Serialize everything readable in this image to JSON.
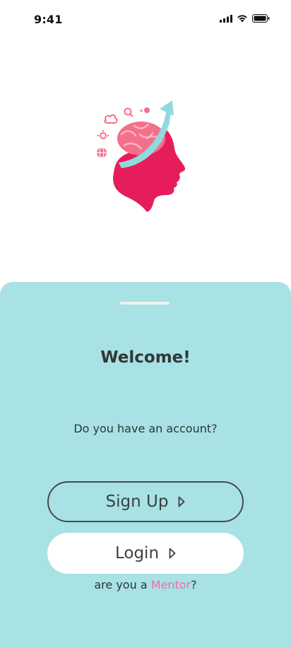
{
  "status_bar": {
    "time": "9:41",
    "icons": [
      "cellular-signal-icon",
      "wifi-icon",
      "battery-icon"
    ]
  },
  "logo": {
    "icon": "brain-head-growth-logo",
    "colors": {
      "face": "#e51e5b",
      "brain": "#f3708a",
      "arrow": "#8fdadd"
    }
  },
  "sheet": {
    "background": "#a8e2e4",
    "welcome": "Welcome!",
    "question": "Do you have an account?",
    "signup_label": "Sign Up",
    "login_label": "Login",
    "mentor_prefix": "are you a ",
    "mentor_link": "Mentor",
    "mentor_suffix": "?"
  },
  "colors": {
    "accent_pink": "#ef6ea2",
    "text_dark": "#333638"
  }
}
